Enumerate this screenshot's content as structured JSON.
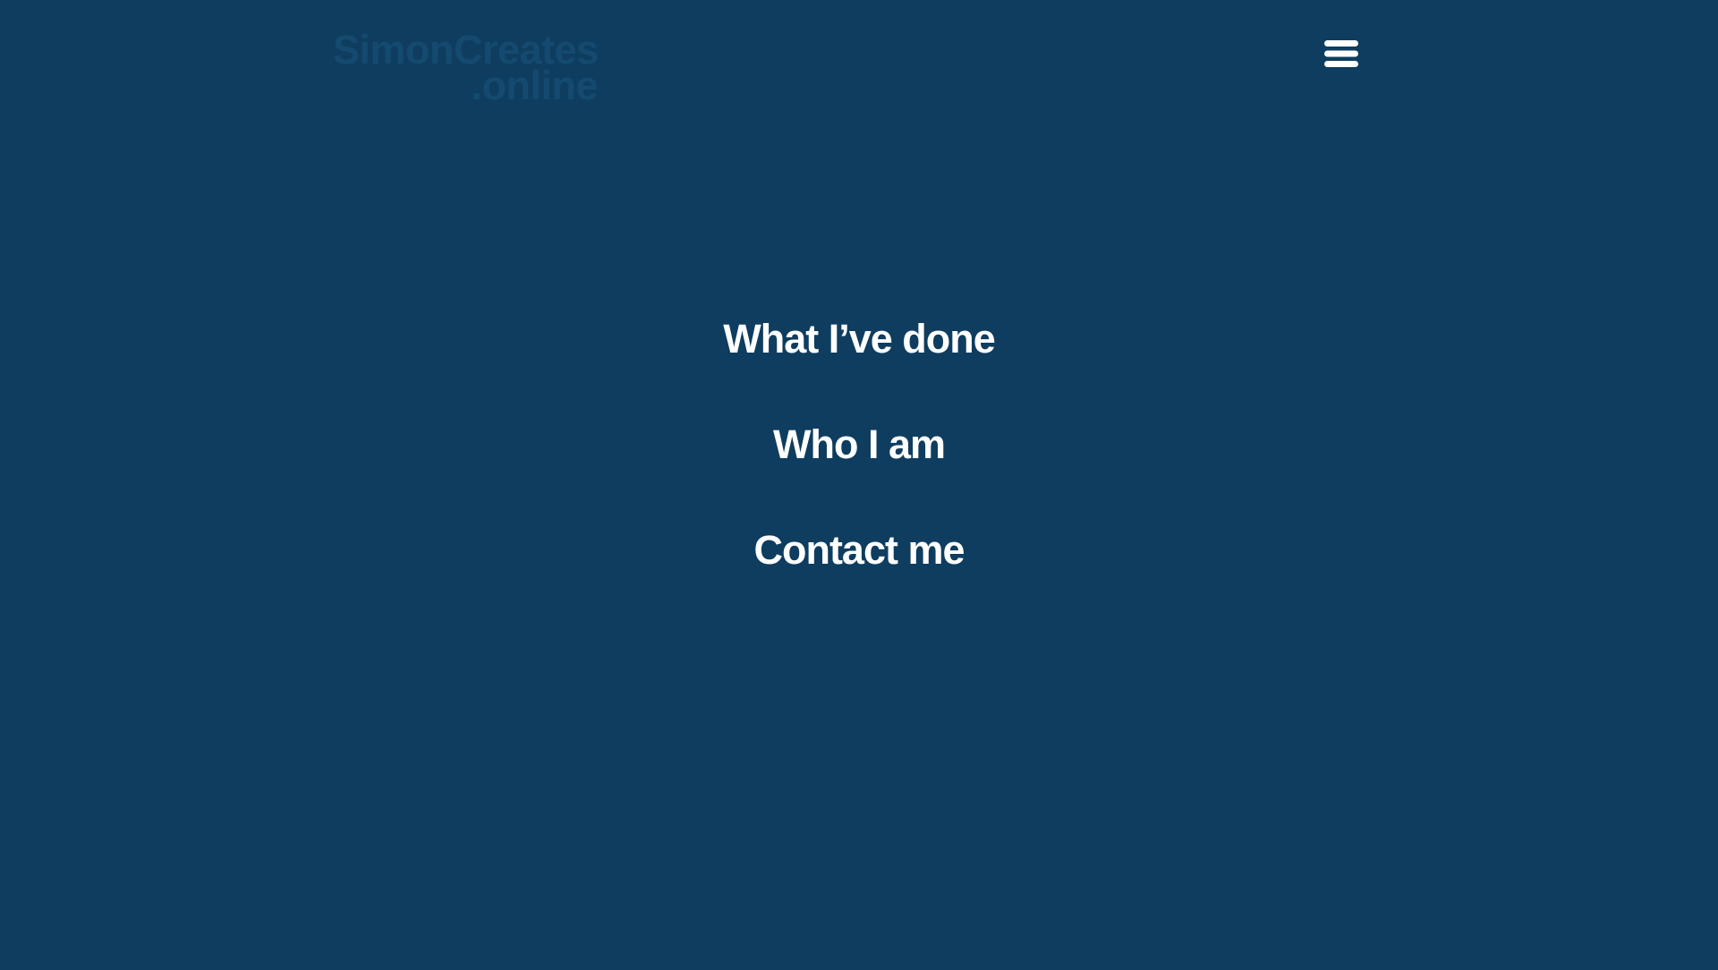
{
  "logo": {
    "line1": "SimonCreates",
    "line2": ".online"
  },
  "menu": {
    "icon": "hamburger-menu-icon"
  },
  "nav": {
    "items": [
      {
        "label": "What I’ve done"
      },
      {
        "label": "Who I am"
      },
      {
        "label": "Contact me"
      }
    ]
  },
  "colors": {
    "background": "#0e3d5f",
    "logo_text": "#154a70",
    "nav_text": "#ffffff"
  }
}
